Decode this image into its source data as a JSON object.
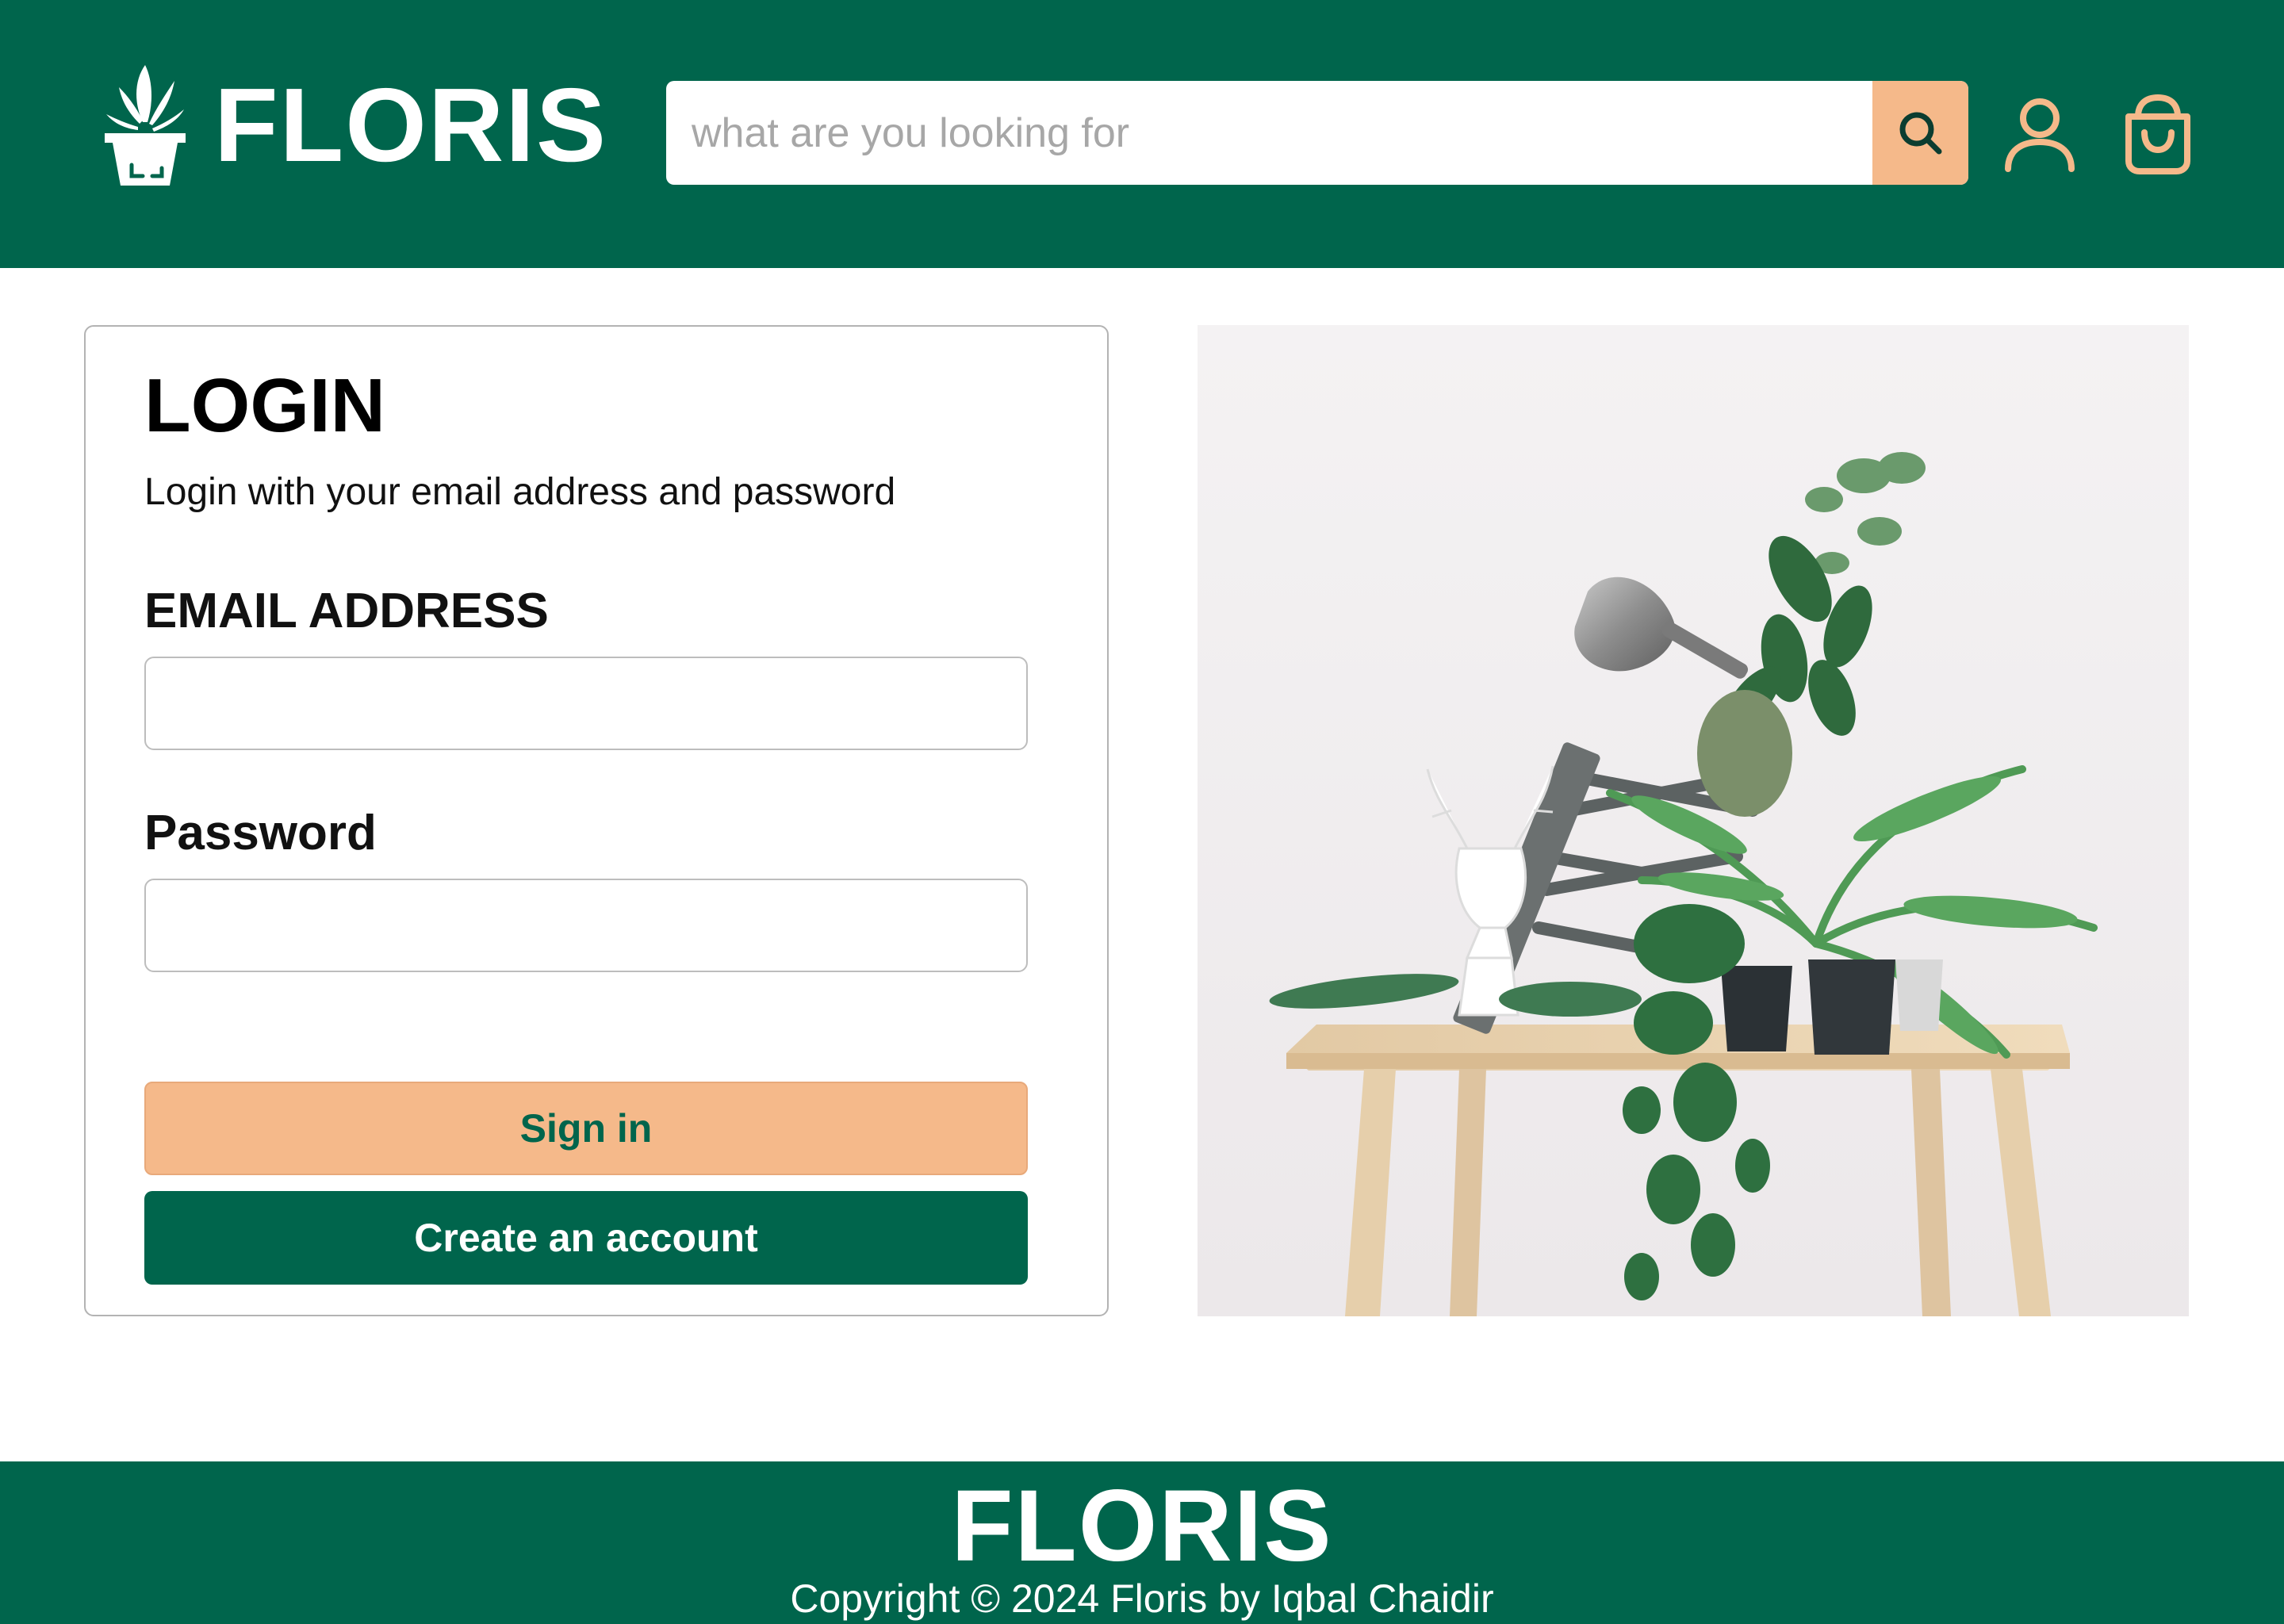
{
  "brand": {
    "name": "FLORIS"
  },
  "header": {
    "search": {
      "placeholder": "what are you looking for",
      "value": ""
    },
    "icons": {
      "search": "search-icon",
      "user": "user-icon",
      "cart": "shopping-bag-icon",
      "logo": "potted-plant-icon"
    }
  },
  "login": {
    "title": "LOGIN",
    "subtitle": "Login with your email address and password",
    "email_label": "EMAIL ADDRESS",
    "email_value": "",
    "password_label": "Password",
    "password_value": "",
    "signin_label": "Sign in",
    "create_label": "Create an account"
  },
  "footer": {
    "logo": "FLORIS",
    "copyright": "Copyright © 2024 Floris by Iqbal Chaidir"
  },
  "colors": {
    "primary": "#00654c",
    "accent": "#f5b98a",
    "white": "#ffffff"
  }
}
